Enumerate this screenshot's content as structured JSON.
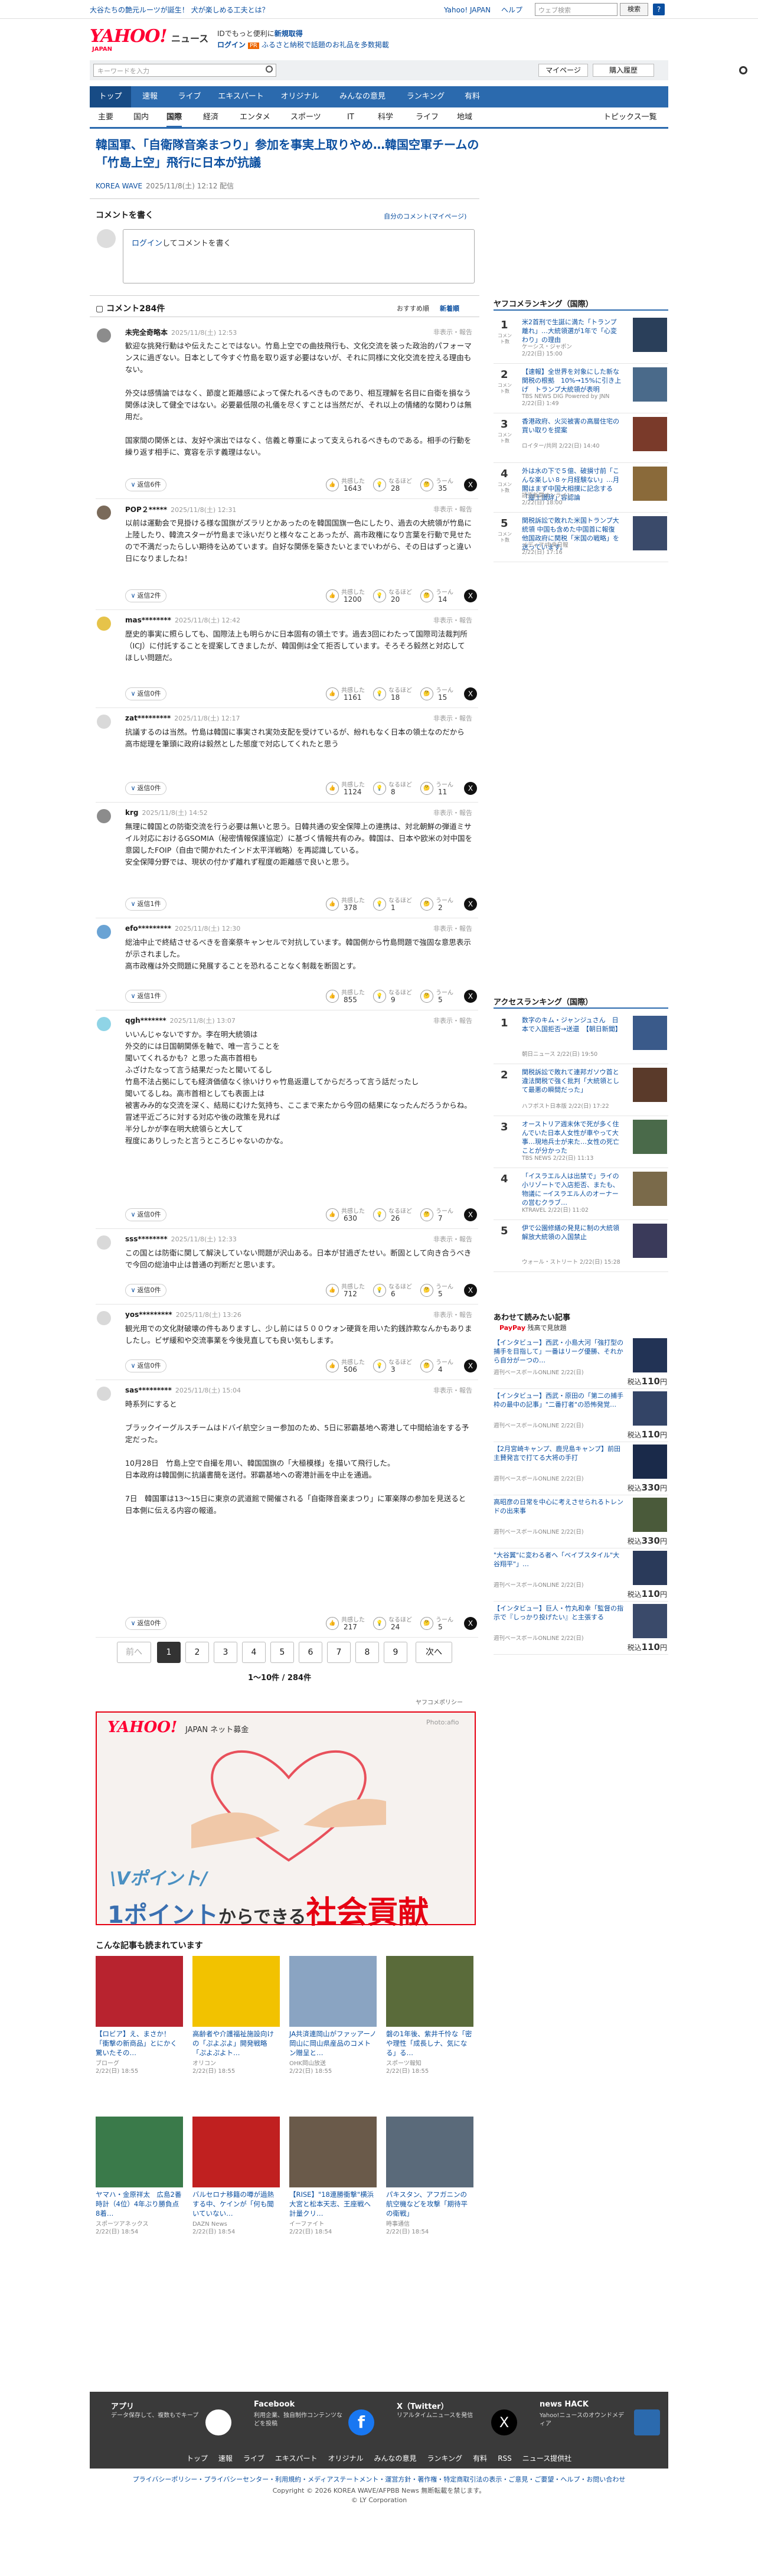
{
  "topbar": {
    "promo": "大谷たちの艶元ルーツが誕生！ 犬が楽しめる工夫とは？",
    "links": [
      "Yahoo! JAPAN",
      "ヘルプ"
    ],
    "search_placeholder": "ウェブ検索",
    "search_button": "検索"
  },
  "header": {
    "logo": "YAHOO!",
    "logo_sub": "JAPAN",
    "service": "ニュース",
    "ad1_prefix": "IDでもっと便利に",
    "ad1_link": "新規取得",
    "ad2_link": "ログイン",
    "ad2_badge": "PR",
    "ad2_text": "ふるさと納税で話題のお礼品を多数掲載"
  },
  "searchbar": {
    "placeholder": "キーワードを入力",
    "mypage": "マイページ",
    "signup": "購入履歴"
  },
  "nav": {
    "main": [
      "トップ",
      "速報",
      "ライブ",
      "エキスパート",
      "オリジナル",
      "みんなの意見",
      "ランキング",
      "有料"
    ],
    "sub": [
      "主要",
      "国内",
      "国際",
      "経済",
      "エンタメ",
      "スポーツ",
      "IT",
      "科学",
      "ライフ",
      "地域"
    ],
    "topics": "トピックス一覧"
  },
  "article": {
    "title": "韓国軍、「自衛隊音楽まつり」参加を事実上取りやめ…韓国空軍チームの「竹島上空」飛行に日本が抗議",
    "source": "KOREA WAVE",
    "date": "2025/11/8(土) 12:12 配信"
  },
  "comment_form": {
    "heading": "コメントを書く",
    "my_comments": "自分のコメント(マイページ)",
    "placeholder_link": "ログイン",
    "placeholder_rest": "してコメントを書く"
  },
  "comments_header": {
    "title": "コメント284件",
    "sort_recommended": "おすすめ順",
    "sort_new": "新着順"
  },
  "reaction_labels": [
    "共感した",
    "なるほど",
    "うーん"
  ],
  "comments": [
    {
      "user": "未完全奇略本",
      "date": "2025/11/8(土) 12:53",
      "more": "非表示・報告",
      "body": "歓迎な挑発行動はや伝えたことではない。竹島上空での曲技飛行も、文化交流を装った政治的パフォーマンスに過ぎない。日本として今すぐ竹島を取り返す必要はないが、それに同様に文化交流を控える理由もない。\n\n外交は感情論ではなく、節度と距離感によって保たれるべきものであり、相互理解を名目に自衛を損なう関係は決して健全ではない。必要最低限の礼儀を尽くすことは当然だが、それ以上の情緒的な関わりは無用だ。\n\n国家間の関係とは、友好や演出ではなく、信義と尊重によって支えられるべきものである。相手の行動を繰り返す相手に、寛容を示す義理はない。",
      "replies": "返信6件",
      "counts": [
        "1643",
        "28",
        "35"
      ]
    },
    {
      "user": "POP２*****",
      "date": "2025/11/8(土) 12:31",
      "more": "非表示・報告",
      "body": "以前は運動会で見掛ける様な国旗がズラリとかあったのを韓国国旗一色にしたり、過去の大統領が竹島に上陸したり、韓流スターが竹島まで泳いだりと様々なことあったが、高市政権になり言葉を行動で見せたので不満だったらしい期待を込めています。自好な関係を築きたいとまでいわがら、その日はずっと違い日になりましたね！",
      "replies": "返信2件",
      "counts": [
        "1200",
        "20",
        "14"
      ]
    },
    {
      "user": "mas********",
      "date": "2025/11/8(土) 12:42",
      "more": "非表示・報告",
      "body": "歴史的事実に照らしても、国際法上も明らかに日本固有の領土です。過去3回にわたって国際司法裁判所（ICJ）に付託することを提案してきましたが、韓国側は全て拒否しています。そろそろ毅然と対応してほしい問題だ。",
      "replies": "返信0件",
      "counts": [
        "1161",
        "18",
        "15"
      ]
    },
    {
      "user": "zat*********",
      "date": "2025/11/8(土) 12:17",
      "more": "非表示・報告",
      "body": "抗議するのは当然。竹島は韓国に事実され実効支配を受けているが、紛れもなく日本の領土なのだから\n高市総理を筆頭に政府は毅然とした態度で対応してくれたと思う",
      "replies": "返信0件",
      "counts": [
        "1124",
        "8",
        "11"
      ]
    },
    {
      "user": "krg",
      "date": "2025/11/8(土) 14:52",
      "more": "非表示・報告",
      "body": "無理に韓国との防衛交流を行う必要は無いと思う。日韓共通の安全保障上の連携は、対北朝鮮の弾道ミサイル対応におけるGSOMIA（秘密情報保護協定）に基づく情報共有のみ。韓国は、日本や欧米の対中国を意図したFOIP（自由で開かれたインド太平洋戦略）を再認識している。\n安全保障分野では、現状の付かず離れず程度の距離感で良いと思う。",
      "replies": "返信1件",
      "counts": [
        "378",
        "1",
        "2"
      ]
    },
    {
      "user": "efo*********",
      "date": "2025/11/8(土) 12:30",
      "more": "非表示・報告",
      "body": "総油中止で終結させるべきを音楽祭キャンセルで対抗しています。韓国側から竹島問題で強固な意思表示が示されました。\n高市政権は外交問題に発展することを恐れることなく制裁を断固とす。",
      "replies": "返信1件",
      "counts": [
        "855",
        "9",
        "5"
      ]
    },
    {
      "user": "qgh*******",
      "date": "2025/11/8(土) 13:07",
      "more": "非表示・報告",
      "body": "いいんじゃないですか。李在明大統領は\n外交的には日国朝関係を軸で、唯一言うことを\n聞いてくれるかも？と思った高市首相も\nふざけたなって言う結果だったと聞いてるし\n竹島不法占拠にしても経済価値なく徐いけりゃ竹島返還してからだろって言う話だったし\n聞いてるしね。高市首相としても表面上は\n被害みみ的な交流を深く、結局にむけた気持ち、ここまで来たから今回の結果になったんだろうからね。\n冒述平近ごろに対する対応や後の政策を見れば\n半分しかが李在明大統領らと大して\n程度にありしったと言うところじゃないのかな。",
      "replies": "返信0件",
      "counts": [
        "630",
        "26",
        "7"
      ]
    },
    {
      "user": "sss********",
      "date": "2025/11/8(土) 12:33",
      "more": "非表示・報告",
      "body": "この国とは防衛に関して解決していない問題が沢山ある。日本が甘過ぎたせい。断固として向き合うべきで今回の総油中止は普通の判断だと思います。",
      "replies": "返信0件",
      "counts": [
        "712",
        "6",
        "5"
      ]
    },
    {
      "user": "yos*********",
      "date": "2025/11/8(土) 13:26",
      "more": "非表示・報告",
      "body": "観光用での文化財破壊の件もありますし、少し前には５００ウォン硬貨を用いた釣銭詐欺なんかもありましたし。ビザ緩和や交流事業を今後見直しても良い気もします。",
      "replies": "返信0件",
      "counts": [
        "506",
        "3",
        "4"
      ]
    },
    {
      "user": "sas*********",
      "date": "2025/11/8(土) 15:04",
      "more": "非表示・報告",
      "body": "時系列にすると\n\nブラックイーグルスチームはドバイ航空ショー参加のため、5日に邪霸基地へ寄港して中間給油をする予定だった。\n\n10月28日　竹島上空で自撮を用い、韓国国旗の「大極模様」を描いて飛行した。\n日本政府は韓国側に抗議書簡を送付。邪霸基地への寄港計画を中止を通過。\n\n7日　韓国軍は13〜15日に東京の武道館で開催される「自衛隊音楽まつり」に軍楽隊の参加を見送ると日本側に伝える内容の報道。",
      "replies": "返信0件",
      "counts": [
        "217",
        "24",
        "5"
      ]
    }
  ],
  "pagination": {
    "prev": "前へ",
    "pages": [
      "1",
      "2",
      "3",
      "4",
      "5",
      "6",
      "7",
      "8",
      "9"
    ],
    "next": "次へ",
    "info": "1〜10件 / 284件"
  },
  "ad": {
    "policy": "ヤフコメポリシー",
    "logo": "YAHOO!",
    "sub": "JAPAN  ネット募金",
    "photo": "Photo:afio",
    "line1": "\\Vポイント/",
    "line2_a": "1ポイント",
    "line2_b": "からできる",
    "line2_c": "社会貢献"
  },
  "recommended": {
    "heading": "こんな記事も読まれています",
    "items": [
      {
        "title": "【ロビア】え、まさか！「衝撃の新商品」とにかく驚いたその…",
        "src": "ブローグ",
        "time": "2/22(日) 18:55",
        "color": "#b8232f"
      },
      {
        "title": "高齢者や介護福祉施設向けの「ぷよぷよ」開発戦略「ぷよぷよト…",
        "src": "オリコン",
        "time": "2/22(日) 18:55",
        "color": "#f2c200"
      },
      {
        "title": "JA共済連岡山がファッアーノ岡山に岡山県産品のコメトン贈呈と…",
        "src": "OHK岡山放送",
        "time": "2/22(日) 18:55",
        "color": "#8aa4c2"
      },
      {
        "title": "磐の1年後、紫井千怜な「密や理性「成長しナ、気になる」る…",
        "src": "スポーツ報知",
        "time": "2/22(日) 18:55",
        "color": "#5a6b3a"
      },
      {
        "title": "ヤマハ・金原祥太　広島2番時計（4位）4年ぶり勝負点8着…",
        "src": "スポーツアネックス",
        "time": "2/22(日) 18:54",
        "color": "#3a7a4a"
      },
      {
        "title": "バルセロナ移籍の噂が過熱する中、ケインが「何も聞いていない…",
        "src": "DAZN News",
        "time": "2/22(日) 18:54",
        "color": "#c02020"
      },
      {
        "title": "【RISE】\"18連勝衝撃\"横浜大宮と松本天志、王座戦へ計量クリ…",
        "src": "イーファイト",
        "time": "2/22(日) 18:54",
        "color": "#6a5a4a"
      },
      {
        "title": "パキスタン、アフガニンの航空機などを攻撃「期待平の衛戦」",
        "src": "時事通信",
        "time": "2/22(日) 18:54",
        "color": "#5a6a7a"
      }
    ]
  },
  "sidebar": {
    "ranking_title": "ヤフコメランキング（国際）",
    "ranking": [
      {
        "rank": "1",
        "cat": "コメント数",
        "title": "米2首刑で生誕に満た「トランプ離れ」…大統領選が1年で「心変わり」の理由",
        "src": "ケーシス・ジャポン",
        "time": "2/22(日) 15:00",
        "color": "#2a3f5a"
      },
      {
        "rank": "2",
        "cat": "コメント数",
        "title": "【速報】全世界を対象にした新な関税の根拠　10%→15%に引き上げ　トランプ大統領が表明",
        "src": "TBS NEWS DIG Powered by JNN",
        "time": "2/22(日) 1:49",
        "color": "#4a6a8a"
      },
      {
        "rank": "3",
        "cat": "コメント数",
        "title": "香港政府、火災被害の高層住宅の買い取りを提案",
        "src": "ロイター/共同 2/22(日) 14:40",
        "time": "",
        "color": "#7a3a2a"
      },
      {
        "rank": "4",
        "cat": "コメント数",
        "title": "外は水の下で５億、破損寸前「こんな楽しい８ヶ月経験ない」…月閣はまず中国大相撲に記念する「塵土讃辞」容認論",
        "src": "読売新聞オンライン",
        "time": "2/22(日) 18:00",
        "color": "#8a6a3a"
      },
      {
        "rank": "5",
        "cat": "コメント数",
        "title": "関税訴訟で敗れた米国トランプ大統領  中国も含めた中国首に報復 他国政府に関税「米国の戦略」を送っています。",
        "src": "メディア/中央日報",
        "time": "2/22(日) 17:16",
        "color": "#3a4a6a"
      }
    ],
    "access_title": "アクセスランキング（国際）",
    "access": [
      {
        "rank": "1",
        "title": "数字のキム・ジャンジュさん　日本で入国拒否→送還　【朝日新聞】",
        "src": "朝日ニュース 2/22(日) 19:50",
        "color": "#3a5a8a"
      },
      {
        "rank": "2",
        "title": "関税訴訟で敗れて連邦ガソウ首と違法関税で強く批判「大統領として最悪の瞬間だった」",
        "src": "ハフポスト日本版 2/22(日) 17:22",
        "color": "#5a3a2a"
      },
      {
        "rank": "3",
        "title": "オーストリア週末休で死が多く住んでいた日本人女性が車やって大事…現地兵士が来た…女性の死亡 ことが分かった",
        "src": "TBS NEWS 2/22(日) 11:13",
        "color": "#4a6a4a"
      },
      {
        "rank": "4",
        "title": "「イスラエル人は出禁で」ライの小リゾートで入店拒否、またも、物議に ─イスラエル人のオーナーの営むクラブ…",
        "src": "KTRAVEL 2/22(日) 11:02",
        "color": "#7a6a4a"
      },
      {
        "rank": "5",
        "title": "伊で公園修繕の発見に制の大統領　解放大統領の入国禁止",
        "src": "ウォール・ストリート 2/22(日) 15:28",
        "color": "#3a3a5a"
      }
    ],
    "paypay_title": "あわせて読みたい記事",
    "paypay_logo": "PayPay",
    "paypay_sub": "残高で見放題",
    "paid": [
      {
        "title": "【インタビュー】西武・小島大河「強打型の捕手を目指して」一番はリーグ優勝、それから自分がーつの…",
        "src": "週刊ベースボールONLINE 2/22(日)",
        "price": "110",
        "color": "#223355"
      },
      {
        "title": "【インタビュー】西武・原田の「第二の捕手枠の最中の記事」\"二番打者\"の恐怖発覚…",
        "src": "週刊ベースボールONLINE 2/22(日)",
        "price": "110",
        "color": "#334466"
      },
      {
        "title": "【2月宮崎キャンプ、鹿児島キャンプ】前田主賛発言で打てる大将の手打",
        "src": "週刊ベースボールONLINE 2/22(日)",
        "price": "330",
        "color": "#1a2a4a"
      },
      {
        "title": "高昭彦の日常を中心に考えさせられるトレンドの出来事",
        "src": "週刊ベースボールONLINE 2/22(日)",
        "price": "330",
        "color": "#4a5a3a"
      },
      {
        "title": "\"大谷翼\"に変わる者へ「ベイブスタイル\"大谷翔平\"」…",
        "src": "週刊ベースボールONLINE 2/22(日)",
        "price": "110",
        "color": "#2a3a5a"
      },
      {
        "title": "【インタビュー】巨人・竹丸和幸「監督の指示で『しっかり投げたい』と主張する",
        "src": "週刊ベースボールONLINE 2/22(日)",
        "price": "110",
        "color": "#3a4a6a"
      }
    ]
  },
  "footer": {
    "blocks": [
      {
        "title": "アプリ",
        "desc": "データ保存して、複数もでキープ"
      },
      {
        "title": "Facebook",
        "desc": "利用企業、独自制作コンテンツなどを投稿"
      },
      {
        "title": "X（Twitter）",
        "desc": "リアルタイムニュースを発信"
      },
      {
        "title": "news HACK",
        "desc": "Yahoo!ニュースのオウンドメディア"
      }
    ],
    "nav": [
      "トップ",
      "速報",
      "ライブ",
      "エキスパート",
      "オリジナル",
      "みんなの意見",
      "ランキング",
      "有料",
      "RSS",
      "ニュース提供社"
    ],
    "legal": "プライバシーポリシー・プライバシーセンター・利用規約・メディアステートメント・運営方針・著作権・特定商取引法の表示・ご意見・ご要望・ヘルプ・お問い合わせ",
    "copy1": "Copyright © 2026 KOREA WAVE/AFPBB News 無断転載を禁じます。",
    "copy2": "© LY Corporation"
  },
  "colors": {
    "brand_red": "#ff0033",
    "nav_blue": "#2b6aae",
    "link": "#0b4fa0"
  }
}
